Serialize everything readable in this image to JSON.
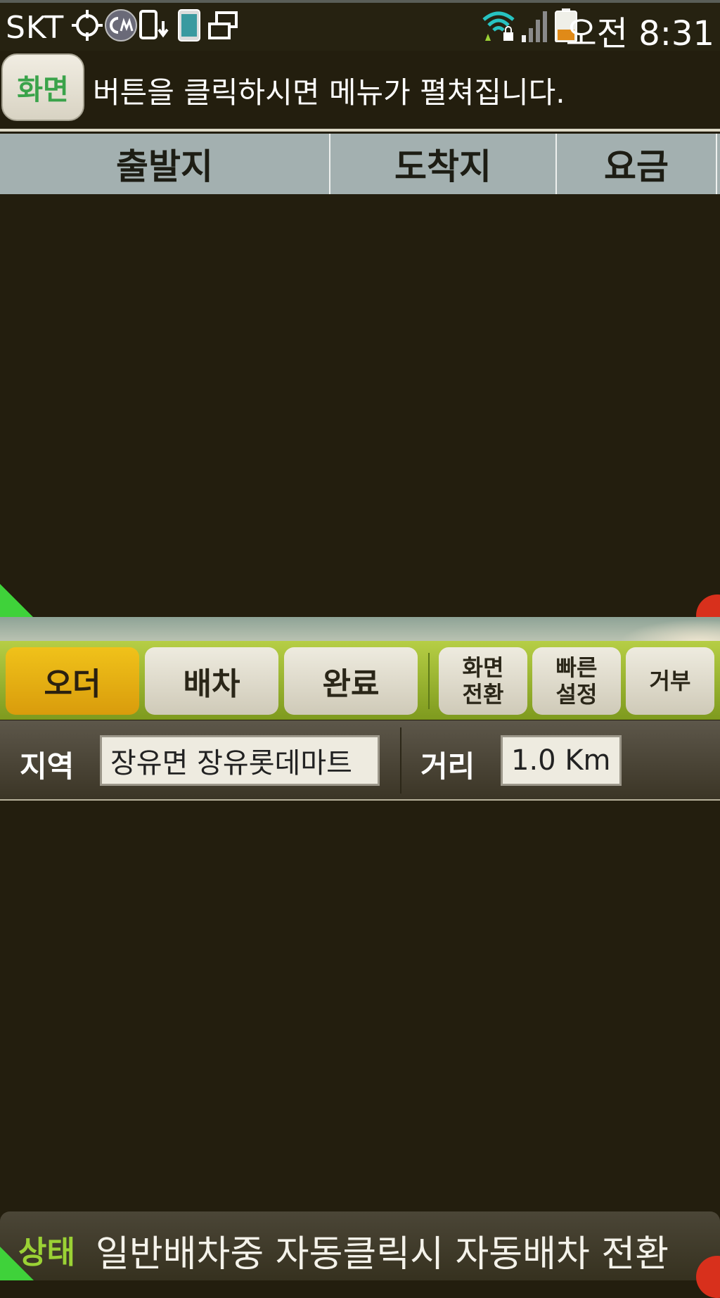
{
  "status_bar": {
    "carrier": "SKT",
    "time": "오전 8:31",
    "icons": [
      "gps-icon",
      "cm-app-icon",
      "phone-download-icon",
      "phone-screen-icon",
      "multi-window-icon",
      "wifi-lock-icon",
      "signal-bars-icon",
      "battery-icon"
    ]
  },
  "info": {
    "screen_button": "화면",
    "message": "버튼을 클릭하시면 메뉴가 펼쳐집니다."
  },
  "table": {
    "columns": [
      "출발지",
      "도착지",
      "요금"
    ]
  },
  "tabs": {
    "order": "오더",
    "dispatch": "배차",
    "complete": "완료",
    "screen_switch": "화면\n전환",
    "quick_setting": "빠른\n설정",
    "reject": "거부"
  },
  "filter": {
    "region_label": "지역",
    "region_value": "장유면 장유롯데마트",
    "distance_label": "거리",
    "distance_value": "1.0 Km"
  },
  "bottom_status": {
    "label": "상태",
    "text": "일반배차중 자동클릭시 자동배차 전환"
  },
  "colors": {
    "background": "#231e0e",
    "tab_bar": "#9bb52e",
    "active_tab": "#e8b212",
    "header": "#a3b0b0",
    "status_label": "#9bd235"
  }
}
